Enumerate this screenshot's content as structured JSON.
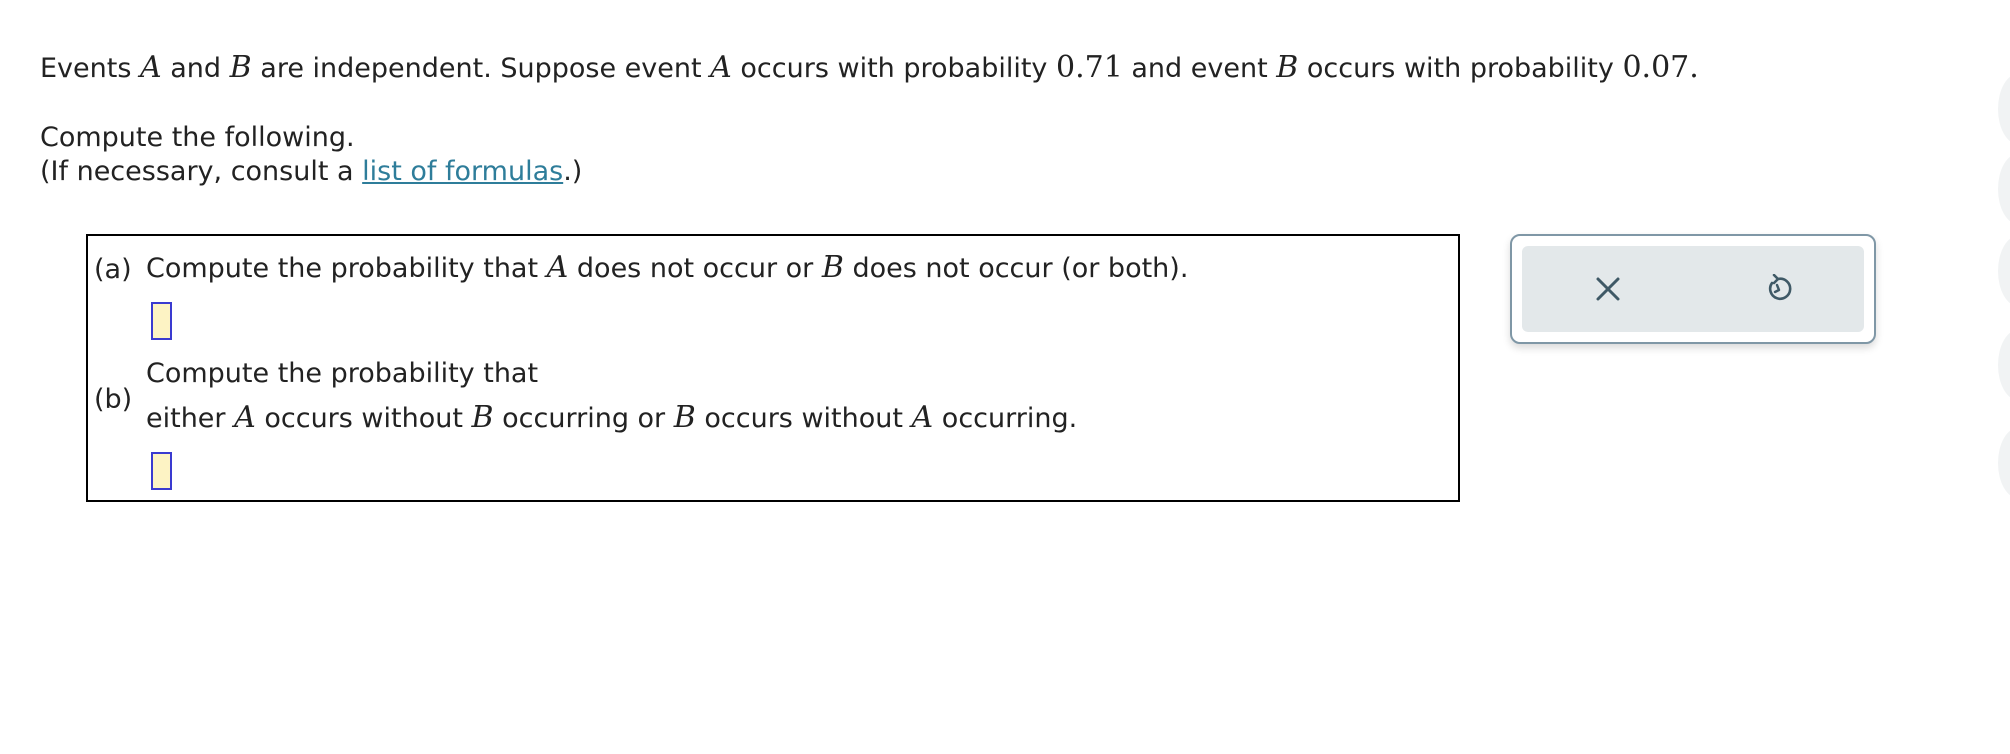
{
  "problem": {
    "prompt": [
      {
        "t": "Events "
      },
      {
        "m": "A"
      },
      {
        "t": " and "
      },
      {
        "m": "B"
      },
      {
        "t": " are independent. Suppose event "
      },
      {
        "m": "A"
      },
      {
        "t": " occurs with probability "
      },
      {
        "n": "0.71"
      },
      {
        "t": " and event "
      },
      {
        "m": "B"
      },
      {
        "t": " occurs with probability "
      },
      {
        "n": "0.07."
      }
    ],
    "instruction": "Compute the following.",
    "consult_prefix": "(If necessary, consult a ",
    "consult_link": "list of formulas",
    "consult_suffix": ".)"
  },
  "part_a": {
    "label": "(a)",
    "text": [
      {
        "t": "Compute the probability that "
      },
      {
        "m": "A"
      },
      {
        "t": " does not occur or "
      },
      {
        "m": "B"
      },
      {
        "t": " does not occur (or both)."
      }
    ],
    "answer": ""
  },
  "part_b": {
    "label": "(b)",
    "line1": "Compute the probability that",
    "line2": [
      {
        "t": "either "
      },
      {
        "m": "A"
      },
      {
        "t": " occurs without "
      },
      {
        "m": "B"
      },
      {
        "t": " occurring or "
      },
      {
        "m": "B"
      },
      {
        "t": " occurs without "
      },
      {
        "m": "A"
      },
      {
        "t": " occurring."
      }
    ],
    "answer": ""
  },
  "toolbar": {
    "clear_icon": "close-icon",
    "undo_icon": "undo-icon"
  },
  "colors": {
    "link": "#2e7d9a",
    "answer_fill": "#fdf3c4",
    "answer_border": "#3a3ad0",
    "tool_bg": "#e3e8ea",
    "icon": "#3f5966"
  }
}
